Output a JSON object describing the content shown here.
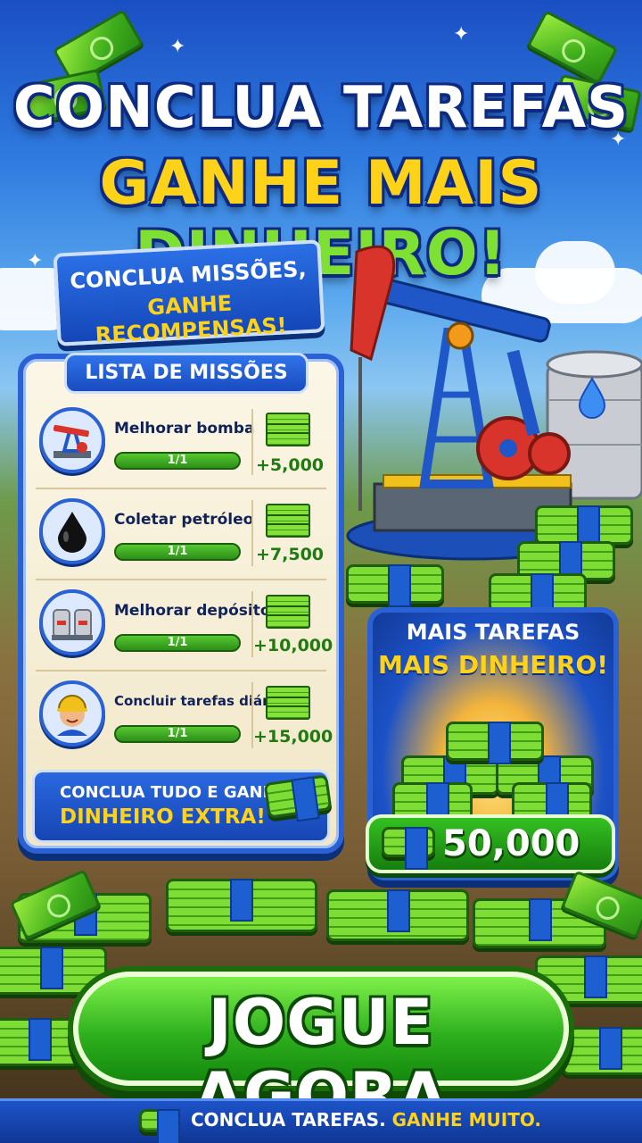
{
  "header": {
    "title_line1": "CONCLUA TAREFAS",
    "title_line2_part1": "GANHE MAIS ",
    "title_line2_part2": "DINHEIRO!"
  },
  "ribbon": {
    "line1": "CONCLUA MISSÕES,",
    "line2": "GANHE RECOMPENSAS!"
  },
  "missions_panel": {
    "title": "LISTA DE MISSÕES",
    "items": [
      {
        "label": "Melhorar bomba",
        "progress": "1/1",
        "reward": "+5,000",
        "icon": "pump-icon"
      },
      {
        "label": "Coletar petróleo",
        "progress": "1/1",
        "reward": "+7,500",
        "icon": "oil-drop-icon"
      },
      {
        "label": "Melhorar depósito",
        "progress": "1/1",
        "reward": "+10,000",
        "icon": "tanks-icon"
      },
      {
        "label": "Concluir tarefas diárias",
        "progress": "1/1",
        "reward": "+15,000",
        "icon": "worker-icon"
      }
    ],
    "bonus_line1": "CONCLUA TUDO E GANHE",
    "bonus_line2": "DINHEIRO EXTRA!"
  },
  "right_panel": {
    "line1": "MAIS TAREFAS",
    "line2": "MAIS DINHEIRO!",
    "amount": "50,000"
  },
  "cta": {
    "label": "JOGUE AGORA"
  },
  "footer": {
    "part1": "CONCLUA TAREFAS.",
    "part2": "GANHE MUITO."
  },
  "colors": {
    "accent_blue": "#2a62d6",
    "gold": "#ffd21a",
    "money_green": "#2fb11e"
  }
}
